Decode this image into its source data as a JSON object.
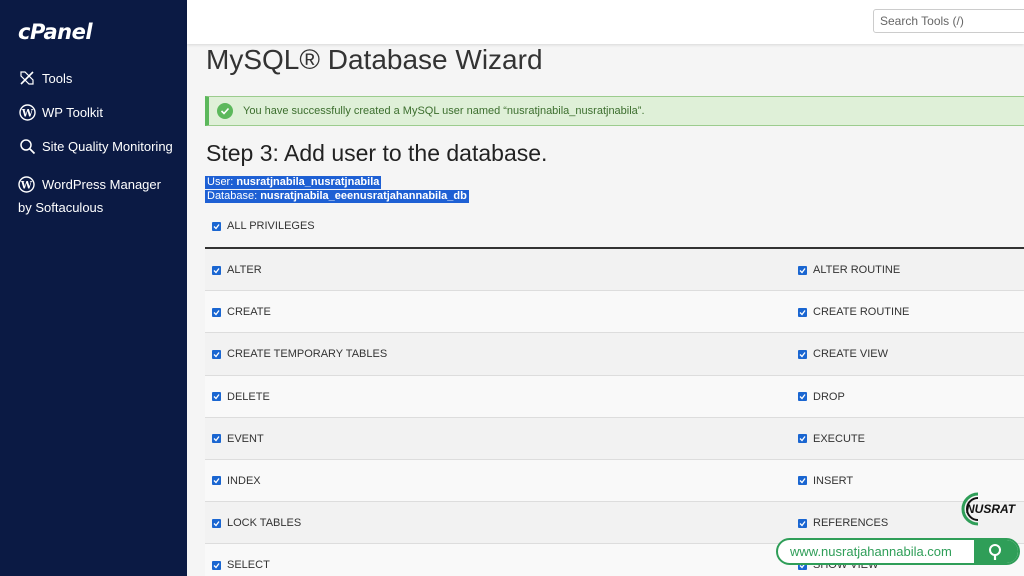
{
  "sidebar": {
    "logo": "cPanel",
    "items": [
      {
        "label": "Tools",
        "icon": "tools-icon"
      },
      {
        "label": "WP Toolkit",
        "icon": "wordpress-icon"
      },
      {
        "label": "Site Quality Monitoring",
        "icon": "magnifier-icon"
      },
      {
        "label": "WordPress Manager by Softaculous",
        "icon": "wordpress-icon"
      }
    ]
  },
  "topbar": {
    "search_placeholder": "Search Tools (/)"
  },
  "main": {
    "title": "MySQL® Database Wizard",
    "alert": "You have successfully created a MySQL user named “nusratjnabila_nusratjnabila”.",
    "step_title": "Step 3: Add user to the database.",
    "user_label": "User: ",
    "user_value": "nusratjnabila_nusratjnabila",
    "db_label": "Database: ",
    "db_value": "nusratjnabila_eeenusratjahannabila_db",
    "all_privileges": "ALL PRIVILEGES",
    "privileges": [
      {
        "left": "ALTER",
        "right": "ALTER ROUTINE"
      },
      {
        "left": "CREATE",
        "right": "CREATE ROUTINE"
      },
      {
        "left": "CREATE TEMPORARY TABLES",
        "right": "CREATE VIEW"
      },
      {
        "left": "DELETE",
        "right": "DROP"
      },
      {
        "left": "EVENT",
        "right": "EXECUTE"
      },
      {
        "left": "INDEX",
        "right": "INSERT"
      },
      {
        "left": "LOCK TABLES",
        "right": "REFERENCES"
      },
      {
        "left": "SELECT",
        "right": "SHOW VIEW"
      }
    ]
  },
  "watermark": {
    "logo_text": "NUSRAT",
    "url": "www.nusratjahannabila.com"
  },
  "colors": {
    "sidebar_bg": "#0b1a44",
    "checkbox": "#1a66d1",
    "success": "#5cb85c",
    "watermark_green": "#2f9e58"
  }
}
